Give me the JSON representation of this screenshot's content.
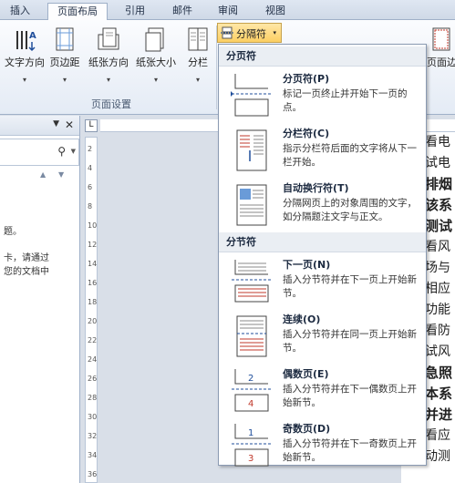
{
  "tabs": [
    {
      "label": "插入",
      "active": false
    },
    {
      "label": "页面布局",
      "active": true
    },
    {
      "label": "引用",
      "active": false
    },
    {
      "label": "邮件",
      "active": false
    },
    {
      "label": "审阅",
      "active": false
    },
    {
      "label": "视图",
      "active": false
    }
  ],
  "ribbon": {
    "buttons": [
      "文字方向",
      "页边距",
      "纸张方向",
      "纸张大小",
      "分栏"
    ],
    "right_button": "页面边",
    "group_label": "页面设置",
    "breaks_button": "分隔符",
    "colors": {
      "highlight": "#fbd46e",
      "accent": "#c0392b"
    }
  },
  "left_panel": {
    "text_lines": [
      "题。",
      "卡，请通过",
      "您的文档中"
    ]
  },
  "vruler_numbers": [
    "2",
    "4",
    "6",
    "8",
    "10",
    "12",
    "14",
    "16",
    "18",
    "20",
    "22",
    "24",
    "26",
    "28",
    "30",
    "32",
    "34",
    "36"
  ],
  "doc_lines": [
    {
      "text": "看电",
      "bold": false
    },
    {
      "text": "试电",
      "bold": false
    },
    {
      "text": "排烟",
      "bold": true
    },
    {
      "text": "该系",
      "bold": true
    },
    {
      "text": "测试",
      "bold": true
    },
    {
      "text": "看风",
      "bold": false
    },
    {
      "text": "场与",
      "bold": false
    },
    {
      "text": "相应",
      "bold": false
    },
    {
      "text": "功能",
      "bold": false
    },
    {
      "text": "看防",
      "bold": false
    },
    {
      "text": "试风",
      "bold": false
    },
    {
      "text": "急照",
      "bold": true
    },
    {
      "text": "本系",
      "bold": true
    },
    {
      "text": "并进",
      "bold": true
    },
    {
      "text": "看应",
      "bold": false
    },
    {
      "text": "动测",
      "bold": false
    }
  ],
  "menu": {
    "section_page": "分页符",
    "section_section": "分节符",
    "items": [
      {
        "title": "分页符(P)",
        "desc": "标记一页终止并开始下一页的点。",
        "icon": "page-break-icon"
      },
      {
        "title": "分栏符(C)",
        "desc": "指示分栏符后面的文字将从下一栏开始。",
        "icon": "column-break-icon"
      },
      {
        "title": "自动换行符(T)",
        "desc": "分隔网页上的对象周围的文字，如分隔题注文字与正文。",
        "icon": "text-wrapping-break-icon"
      },
      {
        "title": "下一页(N)",
        "desc": "插入分节符并在下一页上开始新节。",
        "icon": "next-page-break-icon"
      },
      {
        "title": "连续(O)",
        "desc": "插入分节符并在同一页上开始新节。",
        "icon": "continuous-break-icon"
      },
      {
        "title": "偶数页(E)",
        "desc": "插入分节符并在下一偶数页上开始新节。",
        "icon": "even-page-break-icon"
      },
      {
        "title": "奇数页(D)",
        "desc": "插入分节符并在下一奇数页上开始新节。",
        "icon": "odd-page-break-icon"
      }
    ]
  }
}
